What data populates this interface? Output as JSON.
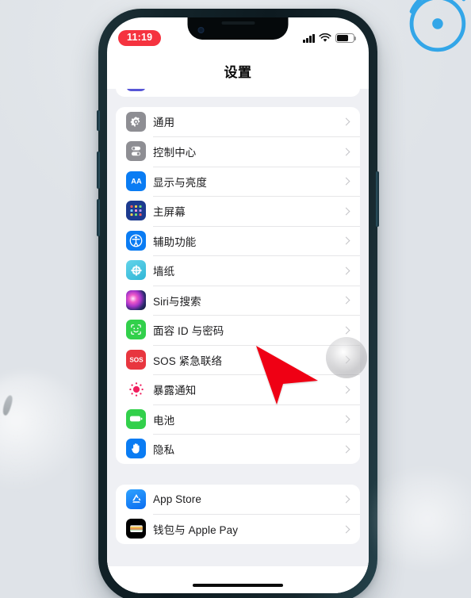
{
  "device": {
    "frame_color": "#13242a",
    "screen_bg": "#eff0f4"
  },
  "status_bar": {
    "time": "11:19",
    "recording_pill_color": "#f5333f",
    "cellular_icon": "signal-bars-icon",
    "wifi_icon": "wifi-icon",
    "battery_icon": "battery-icon"
  },
  "nav": {
    "title": "设置"
  },
  "groups": [
    {
      "id": "group-clipped",
      "rows": [
        {
          "label": "",
          "icon": "screen-time-icon",
          "icon_class": "ic-purple",
          "partial": true
        }
      ]
    },
    {
      "id": "group-system",
      "rows": [
        {
          "label": "通用",
          "icon": "gear-icon",
          "icon_class": "ic-gray"
        },
        {
          "label": "控制中心",
          "icon": "control-center-icon",
          "icon_class": "ic-gray"
        },
        {
          "label": "显示与亮度",
          "icon": "display-brightness-icon",
          "icon_class": "ic-blue"
        },
        {
          "label": "主屏幕",
          "icon": "home-screen-icon",
          "icon_class": "ic-navy"
        },
        {
          "label": "辅助功能",
          "icon": "accessibility-icon",
          "icon_class": "ic-blue"
        },
        {
          "label": "墙纸",
          "icon": "wallpaper-icon",
          "icon_class": "ic-cyan"
        },
        {
          "label": "Siri与搜索",
          "icon": "siri-icon",
          "icon_class": "ic-siri"
        },
        {
          "label": "面容 ID 与密码",
          "icon": "face-id-icon",
          "icon_class": "ic-green"
        },
        {
          "label": "SOS 紧急联络",
          "icon": "sos-icon",
          "icon_class": "ic-red"
        },
        {
          "label": "暴露通知",
          "icon": "exposure-notification-icon",
          "icon_class": "ic-white"
        },
        {
          "label": "电池",
          "icon": "battery-settings-icon",
          "icon_class": "ic-green"
        },
        {
          "label": "隐私",
          "icon": "privacy-hand-icon",
          "icon_class": "ic-blue"
        }
      ]
    },
    {
      "id": "group-stores",
      "rows": [
        {
          "label": "App Store",
          "icon": "app-store-icon",
          "icon_class": "ic-appstore"
        },
        {
          "label": "钱包与 Apple Pay",
          "icon": "wallet-icon",
          "icon_class": "ic-black"
        }
      ]
    }
  ],
  "overlay": {
    "touch_indicator": "touch-highlight-circle",
    "cursor": "red-arrow-cursor",
    "cursor_color": "#ef0014"
  },
  "home_indicator": "home-indicator-bar",
  "decor": {
    "watermark": "blue-circle-watermark",
    "watermark_color": "#2aa3e8"
  }
}
